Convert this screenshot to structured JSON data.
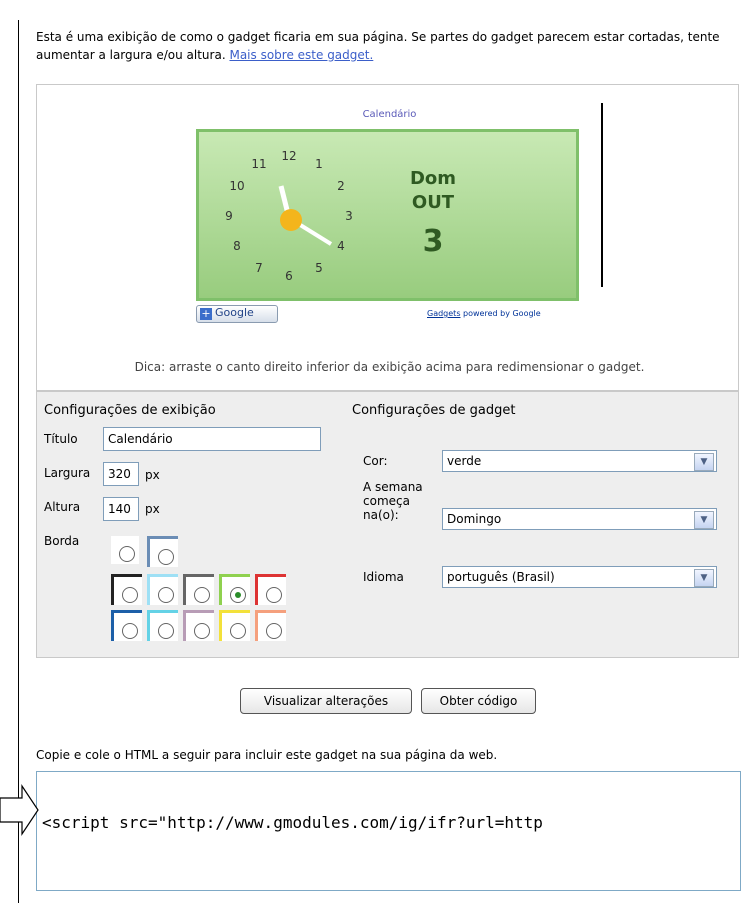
{
  "intro": {
    "text": "Esta é uma exibição de como o gadget ficaria em sua página. Se partes do gadget parecem estar cortadas, tente aumentar a largura e/ou altura.",
    "link": "Mais sobre este gadget."
  },
  "preview": {
    "title": "Calendário",
    "clock_numbers": [
      "12",
      "1",
      "2",
      "3",
      "4",
      "5",
      "6",
      "7",
      "8",
      "9",
      "10",
      "11"
    ],
    "day": "Dom",
    "month": "OUT",
    "date": "3",
    "google_button": "Google",
    "powered": "powered by Google",
    "gadgets_link": "Gadgets",
    "hint": "Dica: arraste o canto direito inferior da exibição acima para redimensionar o gadget."
  },
  "display_config": {
    "heading": "Configurações de exibição",
    "title_label": "Título",
    "title_value": "Calendário",
    "width_label": "Largura",
    "width_value": "320",
    "width_unit": "px",
    "height_label": "Altura",
    "height_value": "140",
    "height_unit": "px",
    "border_label": "Borda"
  },
  "gadget_config": {
    "heading": "Configurações de gadget",
    "color_label": "Cor:",
    "color_value": "verde",
    "week_label": "A semana começa na(o):",
    "week_value": "Domingo",
    "lang_label": "Idioma",
    "lang_value": "português (Brasil)"
  },
  "buttons": {
    "preview": "Visualizar alterações",
    "get_code": "Obter código"
  },
  "code": {
    "label": "Copie e cole o HTML a seguir para incluir este gadget na sua página da web.",
    "snippet": "<script src=\"http://www.gmodules.com/ig/ifr?url=http"
  },
  "colors": {
    "gadget_green": "#98cc7e",
    "link_blue": "#3b5ec9"
  }
}
